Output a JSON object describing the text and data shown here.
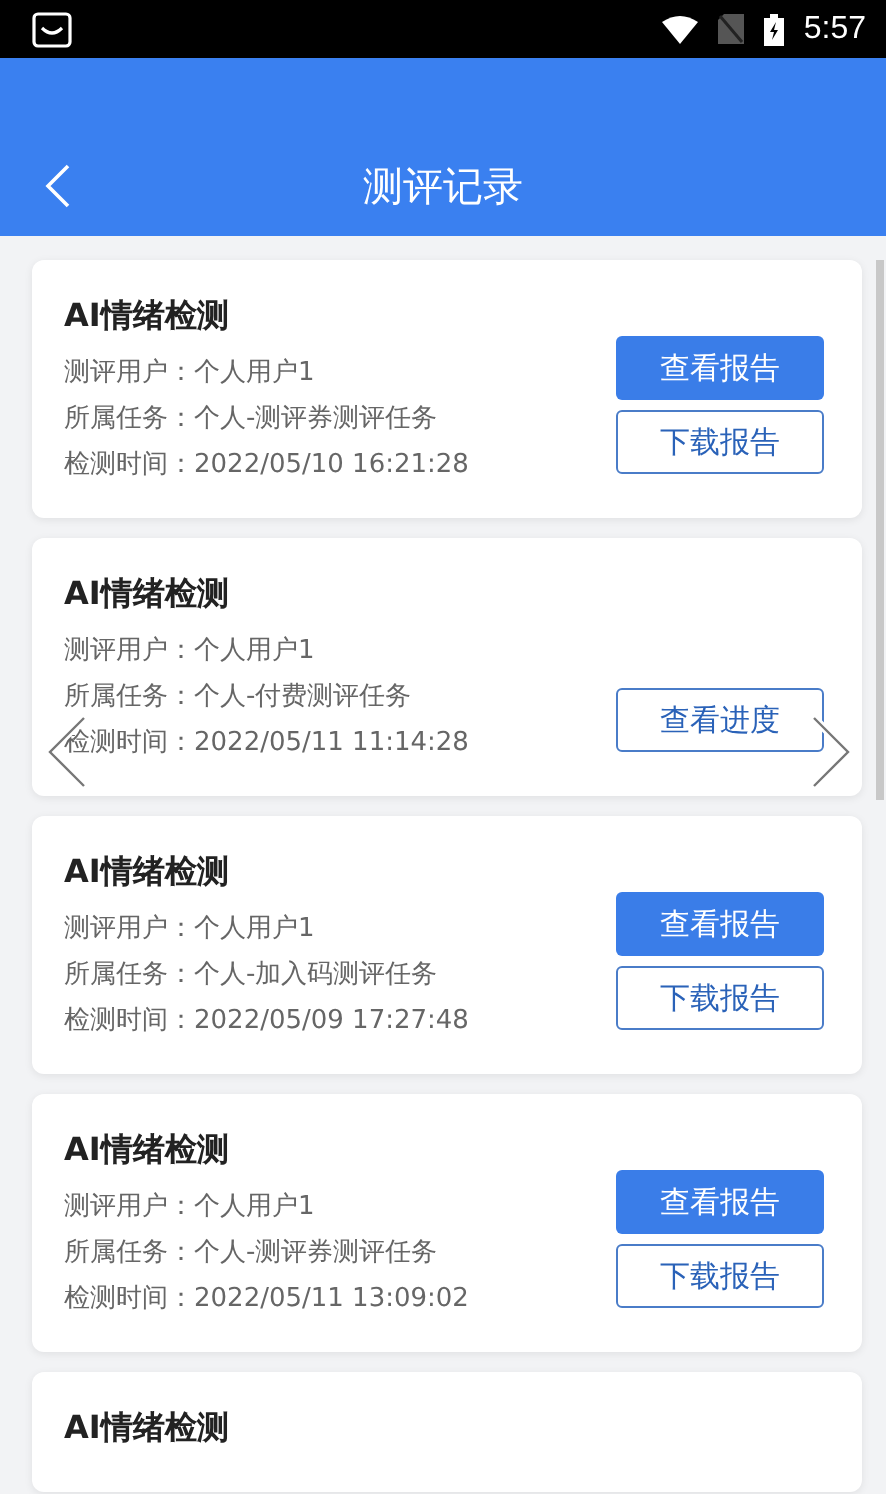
{
  "status_bar": {
    "time": "5:57"
  },
  "header": {
    "title": "测评记录"
  },
  "records": [
    {
      "title": "AI情绪检测",
      "fields": [
        {
          "label": "测评用户：",
          "value": "个人用户1"
        },
        {
          "label": "所属任务：",
          "value": "个人-测评券测评任务"
        },
        {
          "label": "检测时间：",
          "value": "2022/05/10 16:21:28"
        }
      ],
      "buttons": [
        {
          "label": "查看报告",
          "kind": "primary"
        },
        {
          "label": "下载报告",
          "kind": "outline"
        }
      ]
    },
    {
      "title": "AI情绪检测",
      "fields": [
        {
          "label": "测评用户：",
          "value": "个人用户1"
        },
        {
          "label": "所属任务：",
          "value": "个人-付费测评任务"
        },
        {
          "label": "检测时间：",
          "value": "2022/05/11 11:14:28"
        }
      ],
      "buttons": [
        {
          "label": "查看进度",
          "kind": "outline"
        }
      ]
    },
    {
      "title": "AI情绪检测",
      "fields": [
        {
          "label": "测评用户：",
          "value": "个人用户1"
        },
        {
          "label": "所属任务：",
          "value": "个人-加入码测评任务"
        },
        {
          "label": "检测时间：",
          "value": "2022/05/09 17:27:48"
        }
      ],
      "buttons": [
        {
          "label": "查看报告",
          "kind": "primary"
        },
        {
          "label": "下载报告",
          "kind": "outline"
        }
      ]
    },
    {
      "title": "AI情绪检测",
      "fields": [
        {
          "label": "测评用户：",
          "value": "个人用户1"
        },
        {
          "label": "所属任务：",
          "value": "个人-测评券测评任务"
        },
        {
          "label": "检测时间：",
          "value": "2022/05/11 13:09:02"
        }
      ],
      "buttons": [
        {
          "label": "查看报告",
          "kind": "primary"
        },
        {
          "label": "下载报告",
          "kind": "outline"
        }
      ]
    },
    {
      "title": "AI情绪检测"
    }
  ]
}
